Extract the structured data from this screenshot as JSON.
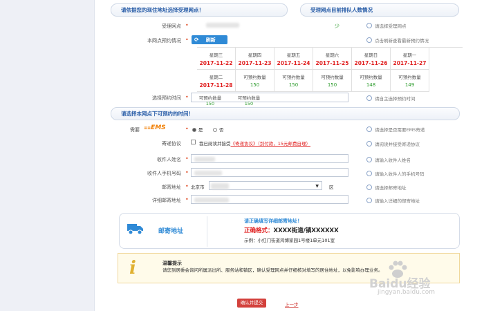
{
  "section1": {
    "title": "请依据您的现住地址选择受理网点！",
    "queue_title": "受理网点目前排队人数情况"
  },
  "form": {
    "branch_label": "受理网点",
    "branch_indicator": "少",
    "branch_hint": "请选择受理网点",
    "booking_label": "本网点预约情况",
    "refresh_label": "刷新",
    "refresh_hint": "点击刷新查看最新预约情况",
    "days_row1": [
      {
        "day": "星期三",
        "date": "2017-11-22"
      },
      {
        "day": "星期四",
        "date": "2017-11-23"
      },
      {
        "day": "星期五",
        "date": "2017-11-24"
      },
      {
        "day": "星期六",
        "date": "2017-11-25"
      },
      {
        "day": "星期日",
        "date": "2017-11-26"
      },
      {
        "day": "星期一",
        "date": "2017-11-27"
      }
    ],
    "days_row2": [
      {
        "day": "星期二",
        "date": "2017-11-28"
      },
      {
        "label": "可预约数量",
        "value": "150"
      },
      {
        "label": "可预约数量",
        "value": "150"
      },
      {
        "label": "可预约数量",
        "value": "150"
      },
      {
        "label": "可预约数量",
        "value": "148"
      },
      {
        "label": "可预约数量",
        "value": "149"
      }
    ],
    "time_label": "选择预约时间",
    "time_slots": [
      {
        "label": "可预约数量",
        "value": "150"
      },
      {
        "label": "可预约数量",
        "value": "150"
      }
    ],
    "time_hint": "请自主选择预约时间"
  },
  "section2": {
    "title": "请选择本网点下可预约的时间！",
    "ems_label": "需要",
    "ems_logo": "EMS",
    "ems_yes": "是",
    "ems_no": "否",
    "ems_hint": "请选择是否需要EMS寄递",
    "agreement_label": "寄递协议",
    "agreement_text": "我已阅读并接受",
    "agreement_link": "《寄递协议》（到付款，15元邮费自理）",
    "agreement_hint": "请阅读并接受寄递协议",
    "name_label": "收件人姓名",
    "name_hint": "请输入收件人姓名",
    "phone_label": "收件人手机号码",
    "phone_hint": "请输入收件人的手机号码",
    "address_label": "邮寄地址",
    "city_value": "北京市",
    "district_suffix": "区",
    "address_hint": "请选择邮寄地址",
    "detail_label": "详细邮寄地址",
    "detail_hint": "请输入详细的邮寄地址"
  },
  "mail_box": {
    "title": "邮寄地址",
    "notice": "请正确填写详细邮寄地址！",
    "format_label": "正确格式：",
    "format_value": "XXXX街道/镇XXXXXX",
    "example": "示例：小红门街道鸿博家园1号楼1单元101室"
  },
  "tip": {
    "title": "温馨提示",
    "body": "请您到居委会询问所属派出所、服务站和镇区，确认受理网点并仔细核对填写的居住地址，以免影响办理业务。"
  },
  "buttons": {
    "confirm": "确认并提交",
    "back": "上一步"
  },
  "watermark": {
    "brand": "Baidu经验",
    "url": "jingyan.baidu.com"
  },
  "colors": {
    "accent_blue": "#2a5ea8",
    "date_red": "#e02020",
    "count_green": "#2a9a2a",
    "button_red": "#d3413c",
    "ems_orange": "#f07d00"
  }
}
